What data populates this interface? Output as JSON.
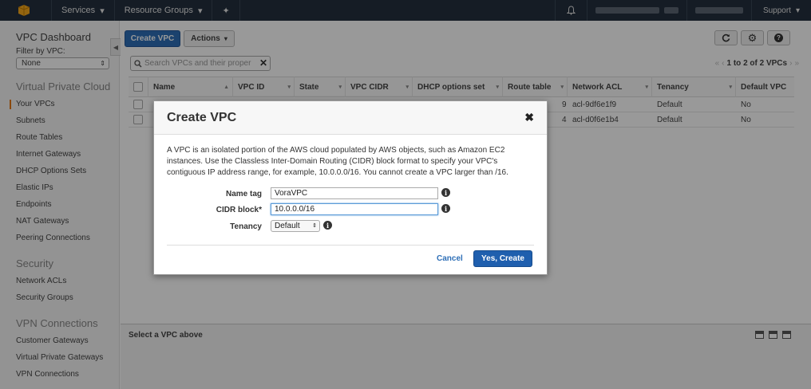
{
  "topbar": {
    "services_label": "Services",
    "resource_groups_label": "Resource Groups",
    "support_label": "Support",
    "colors": {
      "background": "#232f3e",
      "logo": "#f7a81b"
    }
  },
  "sidebar": {
    "title": "VPC Dashboard",
    "filter_label": "Filter by VPC:",
    "filter_value": "None",
    "sections": [
      {
        "title": "Virtual Private Cloud",
        "items": [
          "Your VPCs",
          "Subnets",
          "Route Tables",
          "Internet Gateways",
          "DHCP Options Sets",
          "Elastic IPs",
          "Endpoints",
          "NAT Gateways",
          "Peering Connections"
        ]
      },
      {
        "title": "Security",
        "items": [
          "Network ACLs",
          "Security Groups"
        ]
      },
      {
        "title": "VPN Connections",
        "items": [
          "Customer Gateways",
          "Virtual Private Gateways",
          "VPN Connections"
        ]
      }
    ],
    "active_item": "Your VPCs"
  },
  "toolbar": {
    "create_label": "Create VPC",
    "actions_label": "Actions"
  },
  "search": {
    "placeholder": "Search VPCs and their proper"
  },
  "pager": {
    "text": "1 to 2 of 2 VPCs"
  },
  "table": {
    "columns": [
      "Name",
      "VPC ID",
      "State",
      "VPC CIDR",
      "DHCP options set",
      "Route table",
      "Network ACL",
      "Tenancy",
      "Default VPC"
    ],
    "rows": [
      {
        "network_acl": "acl-9df6e1f9",
        "route_suffix": "9",
        "tenancy": "Default",
        "default_vpc": "No"
      },
      {
        "network_acl": "acl-d0f6e1b4",
        "route_suffix": "4",
        "tenancy": "Default",
        "default_vpc": "No"
      }
    ]
  },
  "detail": {
    "title": "Select a VPC above"
  },
  "dialog": {
    "title": "Create VPC",
    "description": "A VPC is an isolated portion of the AWS cloud populated by AWS objects, such as Amazon EC2 instances. Use the Classless Inter-Domain Routing (CIDR) block format to specify your VPC's contiguous IP address range, for example, 10.0.0.0/16. You cannot create a VPC larger than /16.",
    "name_tag_label": "Name tag",
    "name_tag_value": "VoraVPC",
    "cidr_label": "CIDR block*",
    "cidr_value": "10.0.0.0/16",
    "tenancy_label": "Tenancy",
    "tenancy_value": "Default",
    "cancel_label": "Cancel",
    "ok_label": "Yes, Create"
  }
}
